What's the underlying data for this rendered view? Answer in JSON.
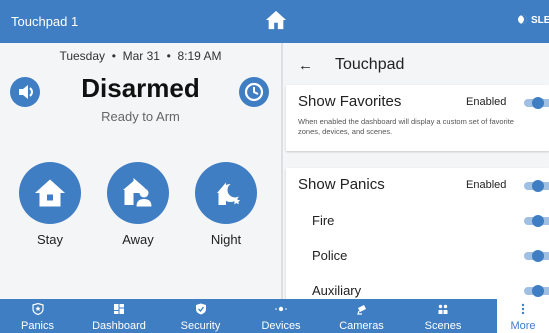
{
  "header": {
    "title": "Touchpad 1",
    "sleep_label": "SLEEP"
  },
  "left": {
    "date": "Tuesday",
    "date2": "Mar 31",
    "time": "8:19 AM",
    "status": "Disarmed",
    "substatus": "Ready to Arm",
    "arm_buttons": [
      {
        "label": "Stay",
        "icon": "house-icon"
      },
      {
        "label": "Away",
        "icon": "people-icon"
      },
      {
        "label": "Night",
        "icon": "moon-icon"
      }
    ]
  },
  "right": {
    "title": "Touchpad",
    "favorites": {
      "title": "Show Favorites",
      "state": "Enabled",
      "enabled": true,
      "description": "When enabled the dashboard will display a custom set of favorite zones, devices, and scenes."
    },
    "panics": {
      "title": "Show Panics",
      "state": "Enabled",
      "enabled": true,
      "items": [
        {
          "label": "Fire",
          "enabled": true
        },
        {
          "label": "Police",
          "enabled": true
        },
        {
          "label": "Auxiliary",
          "enabled": true
        }
      ]
    }
  },
  "nav": {
    "items": [
      {
        "label": "Panics",
        "icon": "shield-star-icon"
      },
      {
        "label": "Dashboard",
        "icon": "dashboard-icon"
      },
      {
        "label": "Security",
        "icon": "security-icon"
      },
      {
        "label": "Devices",
        "icon": "devices-icon"
      },
      {
        "label": "Cameras",
        "icon": "camera-icon"
      },
      {
        "label": "Scenes",
        "icon": "scenes-icon"
      },
      {
        "label": "More",
        "icon": "more-icon"
      }
    ],
    "active": "More"
  },
  "colors": {
    "accent": "#3f7ec3",
    "background": "#f4f5f6"
  }
}
